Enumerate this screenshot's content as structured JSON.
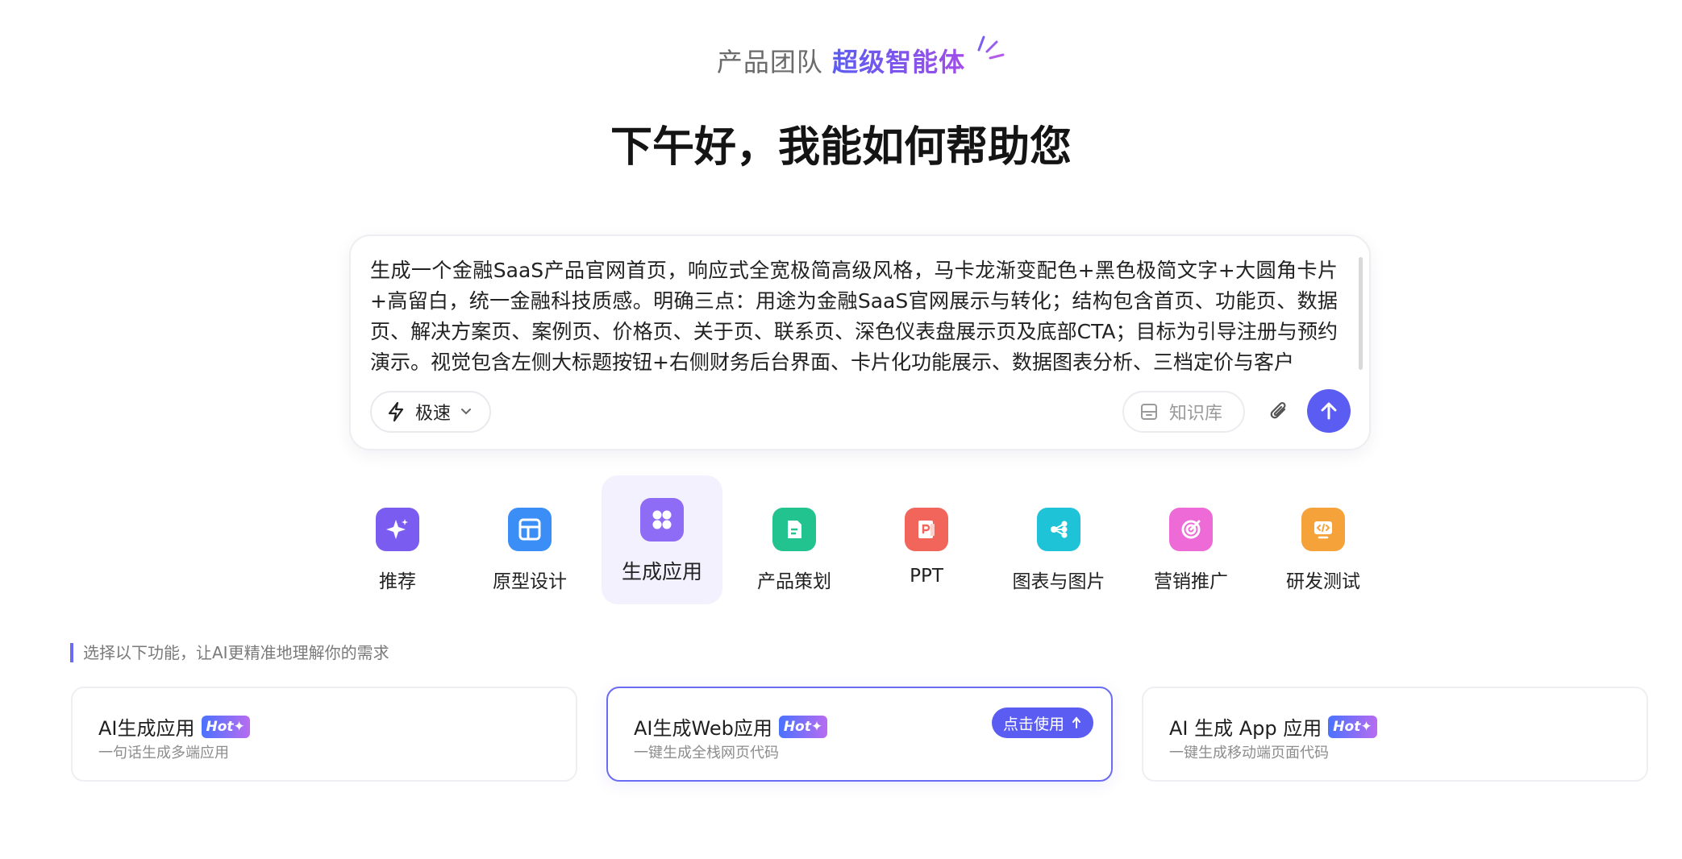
{
  "header": {
    "team_label": "产品团队",
    "agent_label": "超级智能体",
    "greeting": "下午好，我能如何帮助您"
  },
  "prompt": {
    "text": "生成一个金融SaaS产品官网首页，响应式全宽极简高级风格，马卡龙渐变配色+黑色极简文字+大圆角卡片+高留白，统一金融科技质感。明确三点：用途为金融SaaS官网展示与转化；结构包含首页、功能页、数据页、解决方案页、案例页、价格页、关于页、联系页、深色仪表盘展示页及底部CTA；目标为引导注册与预约演示。视觉包含左侧大标题按钮+右侧财务后台界面、卡片化功能展示、数据图表分析、三档定价与客户",
    "mode_label": "极速",
    "knowledge_label": "知识库"
  },
  "categories": [
    {
      "label": "推荐",
      "icon": "sparkle-icon",
      "color": "#7b5cf0"
    },
    {
      "label": "原型设计",
      "icon": "layout-icon",
      "color": "#3a8ef6"
    },
    {
      "label": "生成应用",
      "icon": "apps-icon",
      "color": "#8e6cf5"
    },
    {
      "label": "产品策划",
      "icon": "document-icon",
      "color": "#22c38e"
    },
    {
      "label": "PPT",
      "icon": "ppt-icon",
      "color": "#f2655a"
    },
    {
      "label": "图表与图片",
      "icon": "share-icon",
      "color": "#1fc3d8"
    },
    {
      "label": "营销推广",
      "icon": "target-icon",
      "color": "#ee6ad6"
    },
    {
      "label": "研发测试",
      "icon": "code-icon",
      "color": "#f6a23a"
    }
  ],
  "hint": "选择以下功能，让AI更精准地理解你的需求",
  "cards": [
    {
      "title": "AI生成应用",
      "badge": "Hot",
      "subtitle": "一句话生成多端应用"
    },
    {
      "title": "AI生成Web应用",
      "badge": "Hot",
      "subtitle": "一键生成全栈网页代码",
      "action": "点击使用"
    },
    {
      "title": "AI 生成 App 应用",
      "badge": "Hot",
      "subtitle": "一键生成移动端页面代码"
    }
  ],
  "colors": {
    "accent": "#5b5cf2",
    "active_tab_bg": "#f3f1fd"
  }
}
